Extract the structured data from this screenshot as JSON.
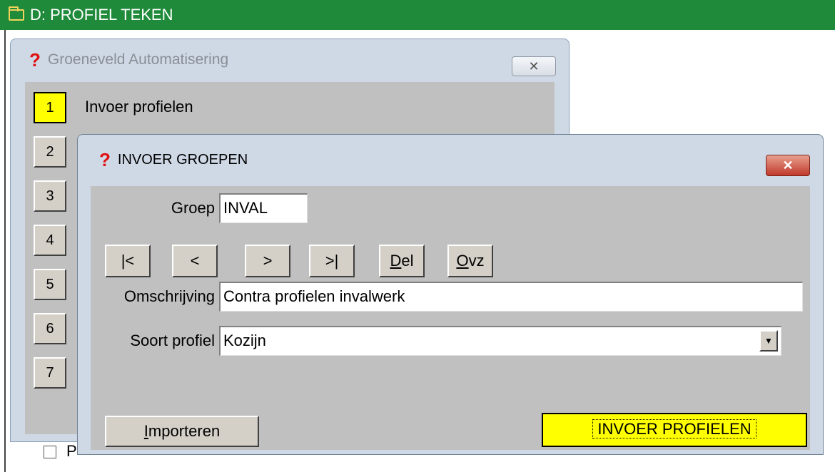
{
  "app": {
    "title": "D: PROFIEL TEKEN"
  },
  "menu_window": {
    "title": "Groeneveld Automatisering",
    "close_label": "✕",
    "items": [
      {
        "number": "1",
        "label": "Invoer profielen"
      },
      {
        "number": "2"
      },
      {
        "number": "3"
      },
      {
        "number": "4"
      },
      {
        "number": "5"
      },
      {
        "number": "6"
      },
      {
        "number": "7"
      }
    ],
    "checkbox_label_partial": "P"
  },
  "dialog": {
    "title": "INVOER GROEPEN",
    "close_label": "✕",
    "groep": {
      "label": "Groep",
      "value": "INVAL"
    },
    "nav_buttons": [
      {
        "label": "|<"
      },
      {
        "label": "<"
      },
      {
        "label": ">"
      },
      {
        "label": ">|"
      },
      {
        "label": "Del",
        "accel": "D"
      },
      {
        "label": "Ovz",
        "accel": "O"
      }
    ],
    "omschrijving": {
      "label": "Omschrijving",
      "value": "Contra profielen invalwerk"
    },
    "soort_profiel": {
      "label": "Soort profiel",
      "value": "Kozijn"
    },
    "importeren_button": "Importeren",
    "invoer_profielen_button": "INVOER PROFIELEN"
  },
  "colors": {
    "titlebar": "#1e8a3a",
    "highlight": "#ffff00",
    "close_red": "#c0392b"
  }
}
